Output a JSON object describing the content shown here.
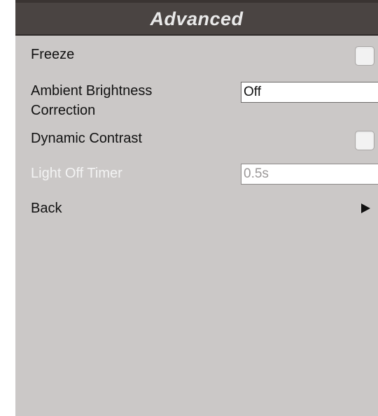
{
  "header": {
    "title": "Advanced"
  },
  "items": [
    {
      "label": "Freeze",
      "control": "checkbox",
      "checked": false
    },
    {
      "label": "Ambient Brightness",
      "label_line2": "Correction",
      "control": "field",
      "value": "Off"
    },
    {
      "label": "Dynamic Contrast",
      "control": "checkbox",
      "checked": false
    },
    {
      "label": "Light Off Timer",
      "control": "field",
      "value": "0.5s",
      "disabled": true
    },
    {
      "label": "Back",
      "control": "arrow",
      "icon": "play-right-icon"
    }
  ],
  "colors": {
    "panel_background": "#cbc8c7",
    "header_background": "#4a4442",
    "header_text": "#e9e9e9",
    "disabled_text": "#f3f3f3"
  }
}
